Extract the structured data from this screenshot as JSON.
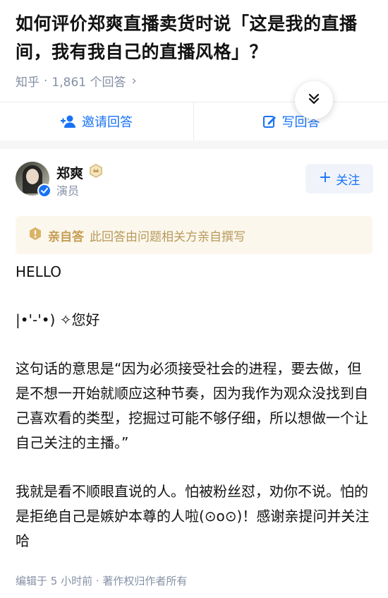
{
  "question": {
    "title": "如何评价郑爽直播卖货时说「这是我的直播间，我有我自己的直播风格」？",
    "source": "知乎",
    "separator": "·",
    "answer_count": "1,861 个回答"
  },
  "actions": {
    "invite_label": "邀请回答",
    "write_label": "写回答"
  },
  "author": {
    "name": "郑爽",
    "tag": "演员",
    "follow_label": "关注"
  },
  "badge": {
    "label": "亲自答",
    "text": "此回答由问题相关方亲自撰写"
  },
  "answer": {
    "paragraphs": [
      "HELLO",
      "|•'-'•) ✧您好",
      "这句话的意思是“因为必须接受社会的进程，要去做，但是不想一开始就顺应这种节奏，因为我作为观众没找到自己喜欢看的类型，挖掘过可能不够仔细，所以想做一个让自己关注的主播。”",
      "我就是看不顺眼直说的人。怕被粉丝怼，劝你不说。怕的是拒绝自己是嫉妒本尊的人啦(⊙o⊙)！感谢亲提问并关注哈"
    ]
  },
  "footer": {
    "text": "编辑于 5 小时前 · 著作权归作者所有"
  },
  "colors": {
    "accent": "#1772f6",
    "muted": "#8590a6",
    "badge_gold": "#c69d52",
    "badge_bg": "#fbf7ed"
  },
  "icons": [
    "add-person-icon",
    "edit-icon",
    "double-chevron-down-icon",
    "verified-icon",
    "gold-badge-icon",
    "plus-icon",
    "quote-badge-icon",
    "chevron-right-icon"
  ]
}
